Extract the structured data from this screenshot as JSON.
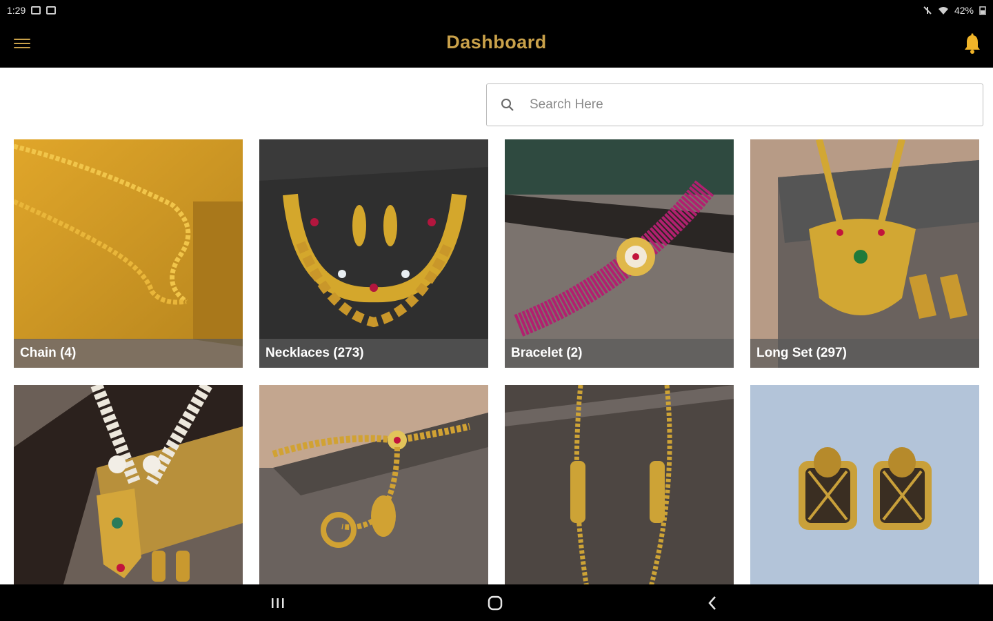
{
  "status_bar": {
    "time": "1:29",
    "battery": "42%"
  },
  "app_bar": {
    "title": "Dashboard"
  },
  "search": {
    "placeholder": "Search Here",
    "value": ""
  },
  "categories": [
    {
      "label": "Chain (4)",
      "image": "gold-chain-photo"
    },
    {
      "label": "Necklaces (273)",
      "image": "gold-necklace-set-photo"
    },
    {
      "label": "Bracelet (2)",
      "image": "pink-bead-bracelet-photo"
    },
    {
      "label": "Long Set (297)",
      "image": "long-set-pendant-photo"
    },
    {
      "label": "",
      "image": "pearl-long-set-photo"
    },
    {
      "label": "",
      "image": "hand-bracelet-ring-photo"
    },
    {
      "label": "",
      "image": "gold-long-chain-photo"
    },
    {
      "label": "",
      "image": "square-earrings-photo"
    }
  ],
  "colors": {
    "accent": "#c9a14a",
    "bar": "#000000"
  }
}
